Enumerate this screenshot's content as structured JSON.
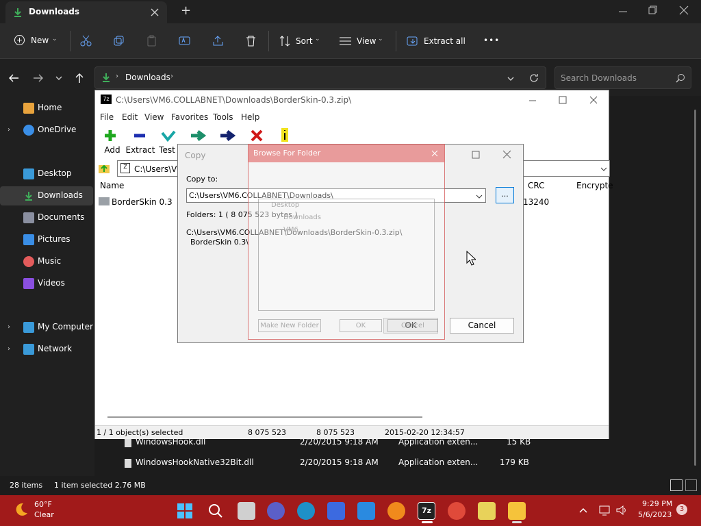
{
  "explorer": {
    "tab_title": "Downloads",
    "new_tab": "+",
    "toolbar": {
      "new": "New",
      "sort": "Sort",
      "view": "View",
      "extract_all": "Extract all",
      "more": "•••"
    },
    "breadcrumb": [
      "Downloads"
    ],
    "search_placeholder": "Search Downloads",
    "sidebar": {
      "items": [
        {
          "label": "Home",
          "color": "#e8a33d"
        },
        {
          "label": "OneDrive",
          "color": "#3a8ee6"
        },
        {
          "label": "Desktop",
          "color": "#3a9ad9"
        },
        {
          "label": "Downloads",
          "color": "#3fae5a"
        },
        {
          "label": "Documents",
          "color": "#8a8fa0"
        },
        {
          "label": "Pictures",
          "color": "#3a8ee6"
        },
        {
          "label": "Music",
          "color": "#e35b5b"
        },
        {
          "label": "Videos",
          "color": "#8a4fe0"
        },
        {
          "label": "My Computer",
          "color": "#3a9ad9"
        },
        {
          "label": "Network",
          "color": "#3a9ad9"
        }
      ]
    },
    "files": [
      {
        "name": "WindowsHook.dll",
        "date": "2/20/2015 9:18 AM",
        "type": "Application exten...",
        "size": "15 KB"
      },
      {
        "name": "WindowsHookNative32Bit.dll",
        "date": "2/20/2015 9:18 AM",
        "type": "Application exten...",
        "size": "179 KB"
      }
    ],
    "status": {
      "items": "28 items",
      "selected": "1 item selected 2.76 MB"
    }
  },
  "sevenzip": {
    "title": "C:\\Users\\VM6.COLLABNET\\Downloads\\BorderSkin-0.3.zip\\",
    "menu": [
      "File",
      "Edit",
      "View",
      "Favorites",
      "Tools",
      "Help"
    ],
    "tools": [
      "Add",
      "Extract",
      "Test"
    ],
    "address": "C:\\Users\\VM",
    "columns": {
      "name": "Name",
      "crc": "CRC",
      "encrypted": "Encrypte"
    },
    "row": {
      "name": "BorderSkin 0.3",
      "crc": "13240"
    },
    "status": {
      "selected": "1 / 1 object(s) selected",
      "size": "8 075 523",
      "packed": "8 075 523",
      "modified": "2015-02-20 12:34:57"
    }
  },
  "copy_dialog": {
    "title": "Copy",
    "copy_to_label": "Copy to:",
    "path": "C:\\Users\\VM6.COLLABNET\\Downloads\\",
    "browse": "...",
    "folders": "Folders: 1    ( 8 075 523 bytes )",
    "source_line1": "C:\\Users\\VM6.COLLABNET\\Downloads\\BorderSkin-0.3.zip\\",
    "source_line2": "BorderSkin 0.3\\",
    "ok": "OK",
    "cancel": "Cancel"
  },
  "browse_dialog": {
    "title": "Browse For Folder",
    "tree": [
      "Desktop",
      "Downloads",
      "VM6"
    ],
    "make_new_folder": "Make New Folder",
    "ok": "OK",
    "cancel": "Cancel"
  },
  "taskbar": {
    "weather_temp": "60°F",
    "weather_desc": "Clear",
    "time": "9:29 PM",
    "date": "5/6/2023",
    "notifications": "3",
    "app_7z": "7z"
  }
}
